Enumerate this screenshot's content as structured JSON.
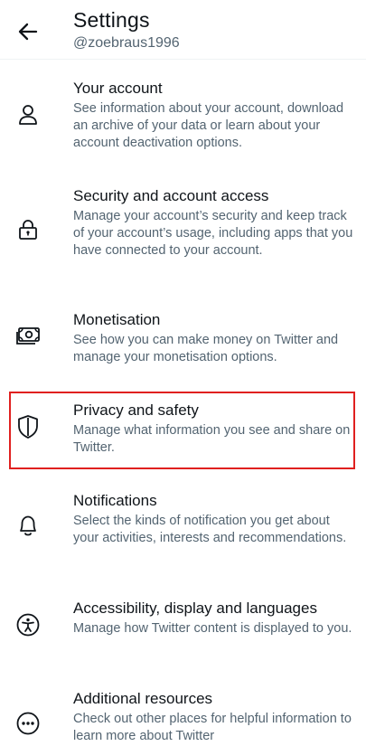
{
  "header": {
    "title": "Settings",
    "username": "@zoebraus1996",
    "back_icon": "arrow-left-icon"
  },
  "items": [
    {
      "icon": "person-icon",
      "title": "Your account",
      "description": "See information about your account, download an archive of your data or learn about your account deactivation options."
    },
    {
      "icon": "lock-icon",
      "title": "Security and account access",
      "description": "Manage your account’s security and keep track of your account’s usage, including apps that you have connected to your account."
    },
    {
      "icon": "money-icon",
      "title": "Monetisation",
      "description": "See how you can make money on Twitter and manage your monetisation options."
    },
    {
      "icon": "shield-icon",
      "title": "Privacy and safety",
      "description": "Manage what information you see and share on Twitter.",
      "highlighted": true
    },
    {
      "icon": "bell-icon",
      "title": "Notifications",
      "description": "Select the kinds of notification you get about your activities, interests and recommendations."
    },
    {
      "icon": "accessibility-icon",
      "title": "Accessibility, display and languages",
      "description": "Manage how Twitter content is displayed to you."
    },
    {
      "icon": "more-circle-icon",
      "title": "Additional resources",
      "description": "Check out other places for helpful information to learn more about Twitter"
    }
  ],
  "colors": {
    "text_primary": "#0f1419",
    "text_secondary": "#536471",
    "highlight": "#e0201f"
  }
}
